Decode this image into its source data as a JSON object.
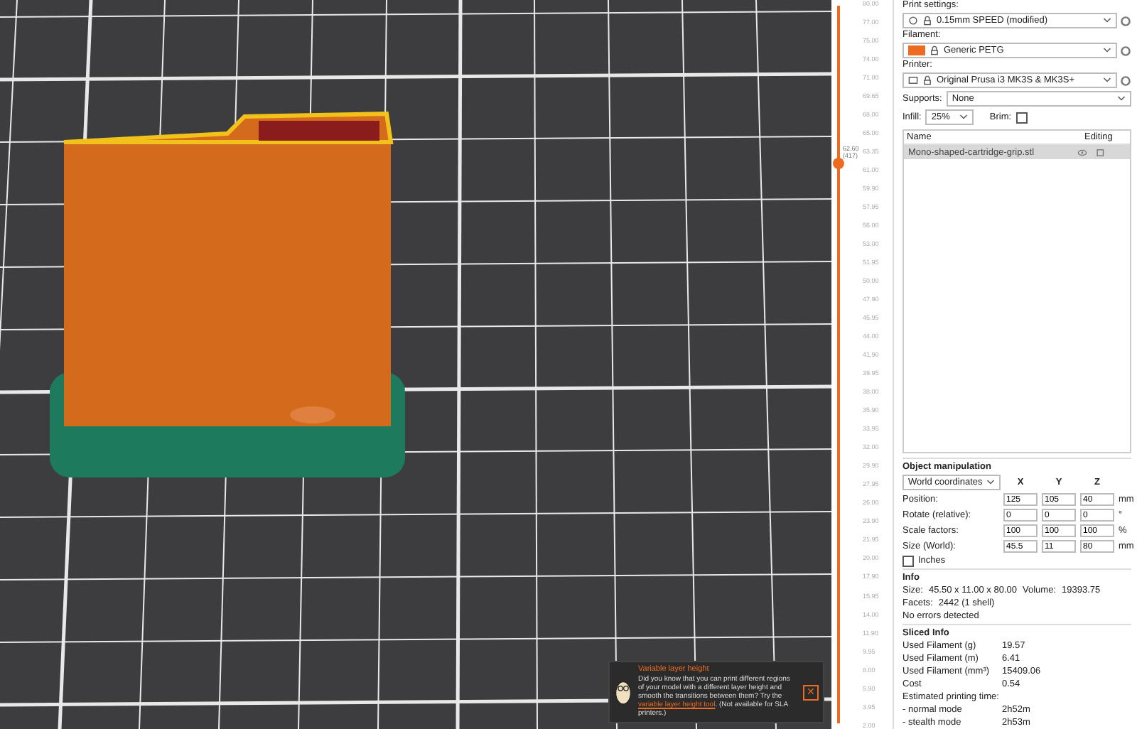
{
  "layer_slider": {
    "level": 0.78,
    "thumb_label": "62.60\n(417)",
    "ticks": [
      "80.00",
      "77.00",
      "75.00",
      "74.00",
      "71.00",
      "69.65",
      "68.00",
      "65.00",
      "63.35",
      "61.00",
      "59.90",
      "57.95",
      "56.00",
      "53.00",
      "51.95",
      "50.00",
      "47.90",
      "45.95",
      "44.00",
      "41.90",
      "39.95",
      "38.00",
      "35.90",
      "33.95",
      "32.00",
      "29.90",
      "27.95",
      "26.00",
      "23.90",
      "21.95",
      "20.00",
      "17.90",
      "15.95",
      "14.00",
      "11.90",
      "9.95",
      "8.00",
      "5.90",
      "3.95",
      "2.00"
    ]
  },
  "notification": {
    "title": "Variable layer height",
    "text_before": "Did you know that you can print different regions of your model with a different layer height and smooth the transitions between them? Try the",
    "link": "variable layer height tool",
    "text_after": ". (Not available for SLA printers.)",
    "close": "✕"
  },
  "sidebar": {
    "presets": [
      {
        "label": "Print settings:",
        "value": "0.15mm SPEED (modified)",
        "kind": "print"
      },
      {
        "label": "Filament:",
        "value": "Generic PETG",
        "kind": "filament"
      },
      {
        "label": "Printer:",
        "value": "Original Prusa i3 MK3S & MK3S+",
        "kind": "printer"
      }
    ],
    "supports": {
      "label": "Supports:",
      "value": "None"
    },
    "infill": {
      "label": "Infill:",
      "value": "25%"
    },
    "brim": {
      "label": "Brim:",
      "checked": false
    },
    "object_list": {
      "columns": [
        "Name",
        "Editing"
      ],
      "rows": [
        {
          "name": "Mono-shaped-cartridge-grip.stl",
          "selected": true
        }
      ]
    },
    "manipulation": {
      "title": "Object manipulation",
      "coordinates": "World coordinates",
      "axes": [
        "X",
        "Y",
        "Z"
      ],
      "rows": [
        {
          "label": "Position:",
          "values": [
            "125",
            "105",
            "40"
          ],
          "unit": "mm"
        },
        {
          "label": "Rotate (relative):",
          "values": [
            "0",
            "0",
            "0"
          ],
          "unit": "°"
        },
        {
          "label": "Scale factors:",
          "values": [
            "100",
            "100",
            "100"
          ],
          "unit": "%"
        },
        {
          "label": "Size (World):",
          "values": [
            "45.5",
            "11",
            "80"
          ],
          "unit": "mm"
        }
      ],
      "inches": {
        "label": "Inches",
        "checked": false
      }
    },
    "info": {
      "title": "Info",
      "size_label": "Size:",
      "size": "45.50 x 11.00 x 80.00",
      "volume_label": "Volume:",
      "volume": "19393.75",
      "facets_label": "Facets:",
      "facets": "2442 (1 shell)",
      "errors": "No errors detected"
    },
    "sliced_info": {
      "title": "Sliced Info",
      "rows": [
        {
          "label": "Used Filament (g)",
          "value": "19.57"
        },
        {
          "label": "Used Filament (m)",
          "value": "6.41"
        },
        {
          "label": "Used Filament (mm³)",
          "value": "15409.06"
        },
        {
          "label": "Cost",
          "value": "0.54"
        }
      ],
      "time_label": "Estimated printing time:",
      "times": [
        {
          "label": "- normal mode",
          "value": "2h52m"
        },
        {
          "label": "- stealth mode",
          "value": "2h53m"
        }
      ]
    }
  }
}
